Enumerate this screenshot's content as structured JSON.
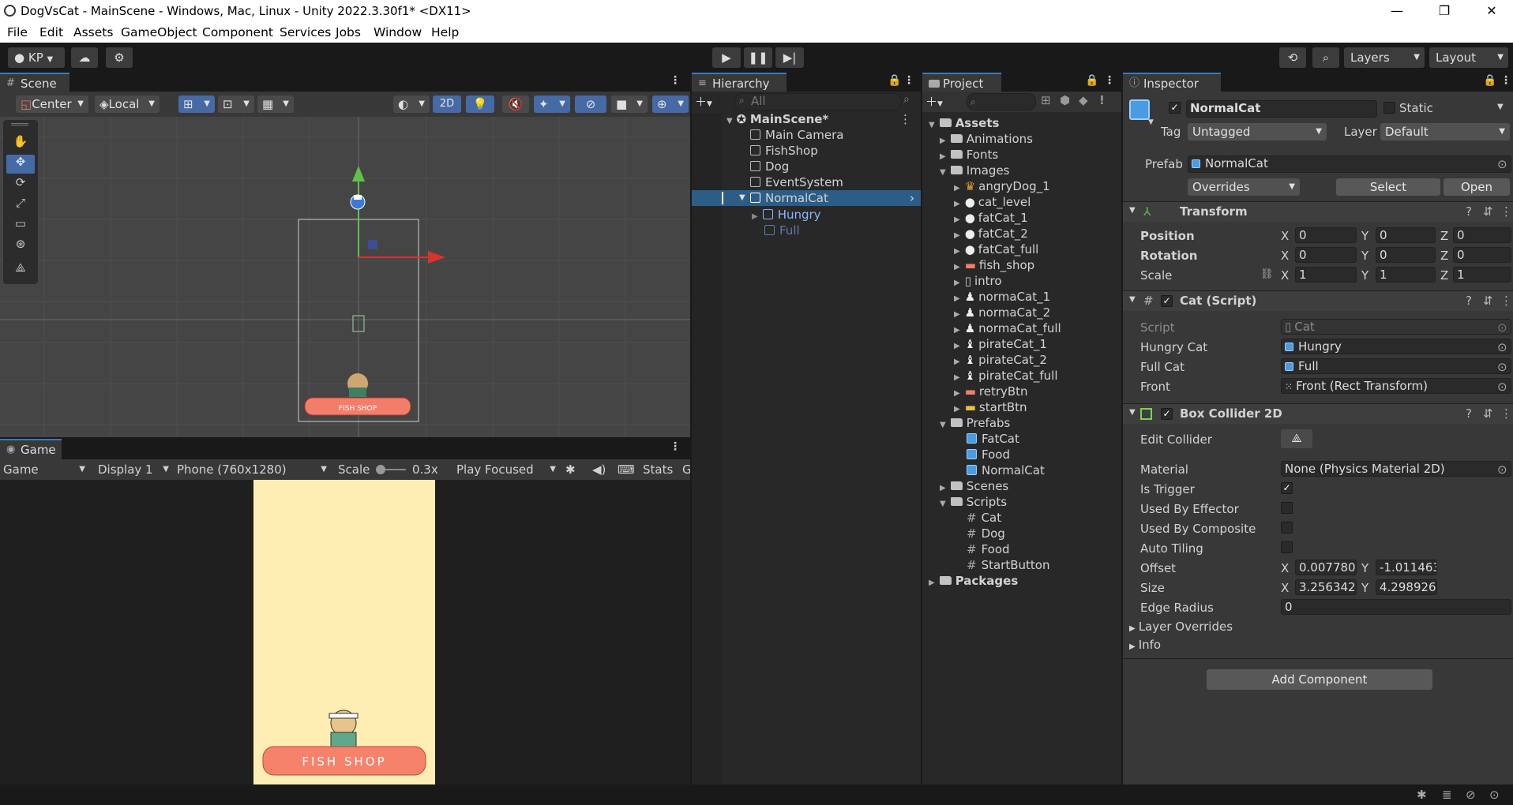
{
  "titlebar": {
    "title": "DogVsCat - MainScene - Windows, Mac, Linux - Unity 2022.3.30f1* <DX11>",
    "minimize": "—",
    "maximize": "❐",
    "close": "✕"
  },
  "menu": [
    "File",
    "Edit",
    "Assets",
    "GameObject",
    "Component",
    "Services",
    "Jobs",
    "Window",
    "Help"
  ],
  "toolbar": {
    "account": "KP",
    "layers": "Layers",
    "layout": "Layout"
  },
  "scene": {
    "tab": "Scene",
    "pivot": "Center",
    "space": "Local",
    "mode2d": "2D",
    "shop_sign": "FISH  SHOP"
  },
  "game": {
    "tab": "Game",
    "view": "Game",
    "display": "Display 1",
    "resolution": "Phone (760x1280)",
    "scale_label": "Scale",
    "scale_value": "0.3x",
    "play_mode": "Play Focused",
    "stats": "Stats",
    "gizmos": "G",
    "shop_sign": "FISH  SHOP"
  },
  "hierarchy": {
    "tab": "Hierarchy",
    "search_placeholder": "All",
    "scene": "MainScene*",
    "items": [
      "Main Camera",
      "FishShop",
      "Dog",
      "EventSystem",
      "NormalCat"
    ],
    "children": [
      "Hungry",
      "Full"
    ]
  },
  "project": {
    "tab": "Project",
    "root": "Assets",
    "folders_top": [
      "Animations",
      "Fonts",
      "Images"
    ],
    "images": [
      "angryDog_1",
      "cat_level",
      "fatCat_1",
      "fatCat_2",
      "fatCat_full",
      "fish_shop",
      "intro",
      "normaCat_1",
      "normaCat_2",
      "normaCat_full",
      "pirateCat_1",
      "pirateCat_2",
      "pirateCat_full",
      "retryBtn",
      "startBtn"
    ],
    "prefabs_folder": "Prefabs",
    "prefabs": [
      "FatCat",
      "Food",
      "NormalCat"
    ],
    "scenes_folder": "Scenes",
    "scripts_folder": "Scripts",
    "scripts": [
      "Cat",
      "Dog",
      "Food",
      "StartButton"
    ],
    "packages": "Packages"
  },
  "inspector": {
    "tab": "Inspector",
    "name": "NormalCat",
    "static": "Static",
    "tag_label": "Tag",
    "tag": "Untagged",
    "layer_label": "Layer",
    "layer": "Default",
    "prefab_label": "Prefab",
    "prefab": "NormalCat",
    "overrides": "Overrides",
    "select": "Select",
    "open": "Open",
    "transform": {
      "title": "Transform",
      "position": "Position",
      "rotation": "Rotation",
      "scale": "Scale",
      "x": "X",
      "y": "Y",
      "z": "Z",
      "pos": [
        "0",
        "0",
        "0"
      ],
      "rot": [
        "0",
        "0",
        "0"
      ],
      "scl": [
        "1",
        "1",
        "1"
      ]
    },
    "cat_script": {
      "title": "Cat (Script)",
      "script_label": "Script",
      "script": "Cat",
      "hungry_label": "Hungry Cat",
      "hungry": "Hungry",
      "full_label": "Full Cat",
      "full": "Full",
      "front_label": "Front",
      "front": "Front (Rect Transform)"
    },
    "box_collider": {
      "title": "Box Collider 2D",
      "edit_collider": "Edit Collider",
      "material_label": "Material",
      "material": "None (Physics Material 2D)",
      "is_trigger": "Is Trigger",
      "used_by_effector": "Used By Effector",
      "used_by_composite": "Used By Composite",
      "auto_tiling": "Auto Tiling",
      "offset_label": "Offset",
      "offset_x": "0.007780",
      "offset_y": "-1.011463",
      "size_label": "Size",
      "size_x": "3.256342",
      "size_y": "4.298926",
      "edge_radius_label": "Edge Radius",
      "edge_radius": "0",
      "layer_overrides": "Layer Overrides",
      "info": "Info"
    },
    "add_component": "Add Component"
  }
}
